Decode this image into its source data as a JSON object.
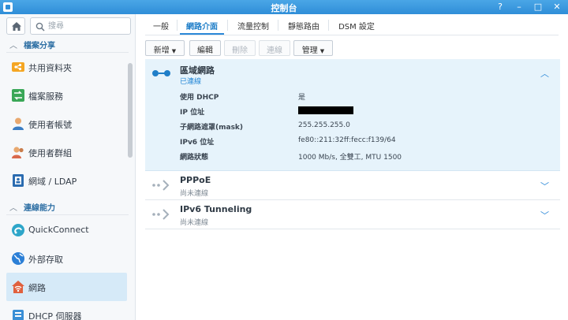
{
  "window": {
    "title": "控制台",
    "help_glyph": "?",
    "minimize_glyph": "–",
    "maximize_glyph": "□",
    "close_glyph": "✕"
  },
  "sidebar": {
    "search_placeholder": "搜尋",
    "sections": [
      {
        "label": "檔案分享"
      },
      {
        "label": "連線能力"
      }
    ],
    "items": [
      {
        "label": "共用資料夾",
        "icon": "shared-folder-icon",
        "color": "#f5a623"
      },
      {
        "label": "檔案服務",
        "icon": "file-services-icon",
        "color": "#3aa757"
      },
      {
        "label": "使用者帳號",
        "icon": "user-icon",
        "color": "#e59b5a"
      },
      {
        "label": "使用者群組",
        "icon": "group-icon",
        "color": "#d9694c"
      },
      {
        "label": "網域 / LDAP",
        "icon": "domain-ldap-icon",
        "color": "#2b6cb0"
      },
      {
        "label": "QuickConnect",
        "icon": "quickconnect-icon",
        "color": "#2ea6c9"
      },
      {
        "label": "外部存取",
        "icon": "globe-icon",
        "color": "#2b7fd6"
      },
      {
        "label": "網路",
        "icon": "network-home-icon",
        "color": "#e0603e",
        "active": true
      },
      {
        "label": "DHCP 伺服器",
        "icon": "dhcp-server-icon",
        "color": "#3a8fd6"
      }
    ]
  },
  "tabs": [
    {
      "label": "一般"
    },
    {
      "label": "網路介面",
      "active": true
    },
    {
      "label": "流量控制"
    },
    {
      "label": "靜態路由"
    },
    {
      "label": "DSM 設定"
    }
  ],
  "toolbar": {
    "create": "新增",
    "edit": "編輯",
    "delete": "刪除",
    "connect": "連線",
    "manage": "管理"
  },
  "interfaces": [
    {
      "name": "區域網路",
      "status": "已連線",
      "connected": true,
      "expanded": true,
      "details": [
        {
          "key": "使用 DHCP",
          "value": "是"
        },
        {
          "key": "IP 位址",
          "value": "",
          "redacted": true
        },
        {
          "key": "子網路遮罩(mask)",
          "value": "255.255.255.0"
        },
        {
          "key": "IPv6 位址",
          "value": "fe80::211:32ff:fecc:f139/64"
        },
        {
          "key": "網路狀態",
          "value": "1000 Mb/s, 全雙工, MTU 1500"
        }
      ]
    },
    {
      "name": "PPPoE",
      "status": "尚未連線",
      "connected": false
    },
    {
      "name": "IPv6 Tunneling",
      "status": "尚未連線",
      "connected": false
    }
  ]
}
